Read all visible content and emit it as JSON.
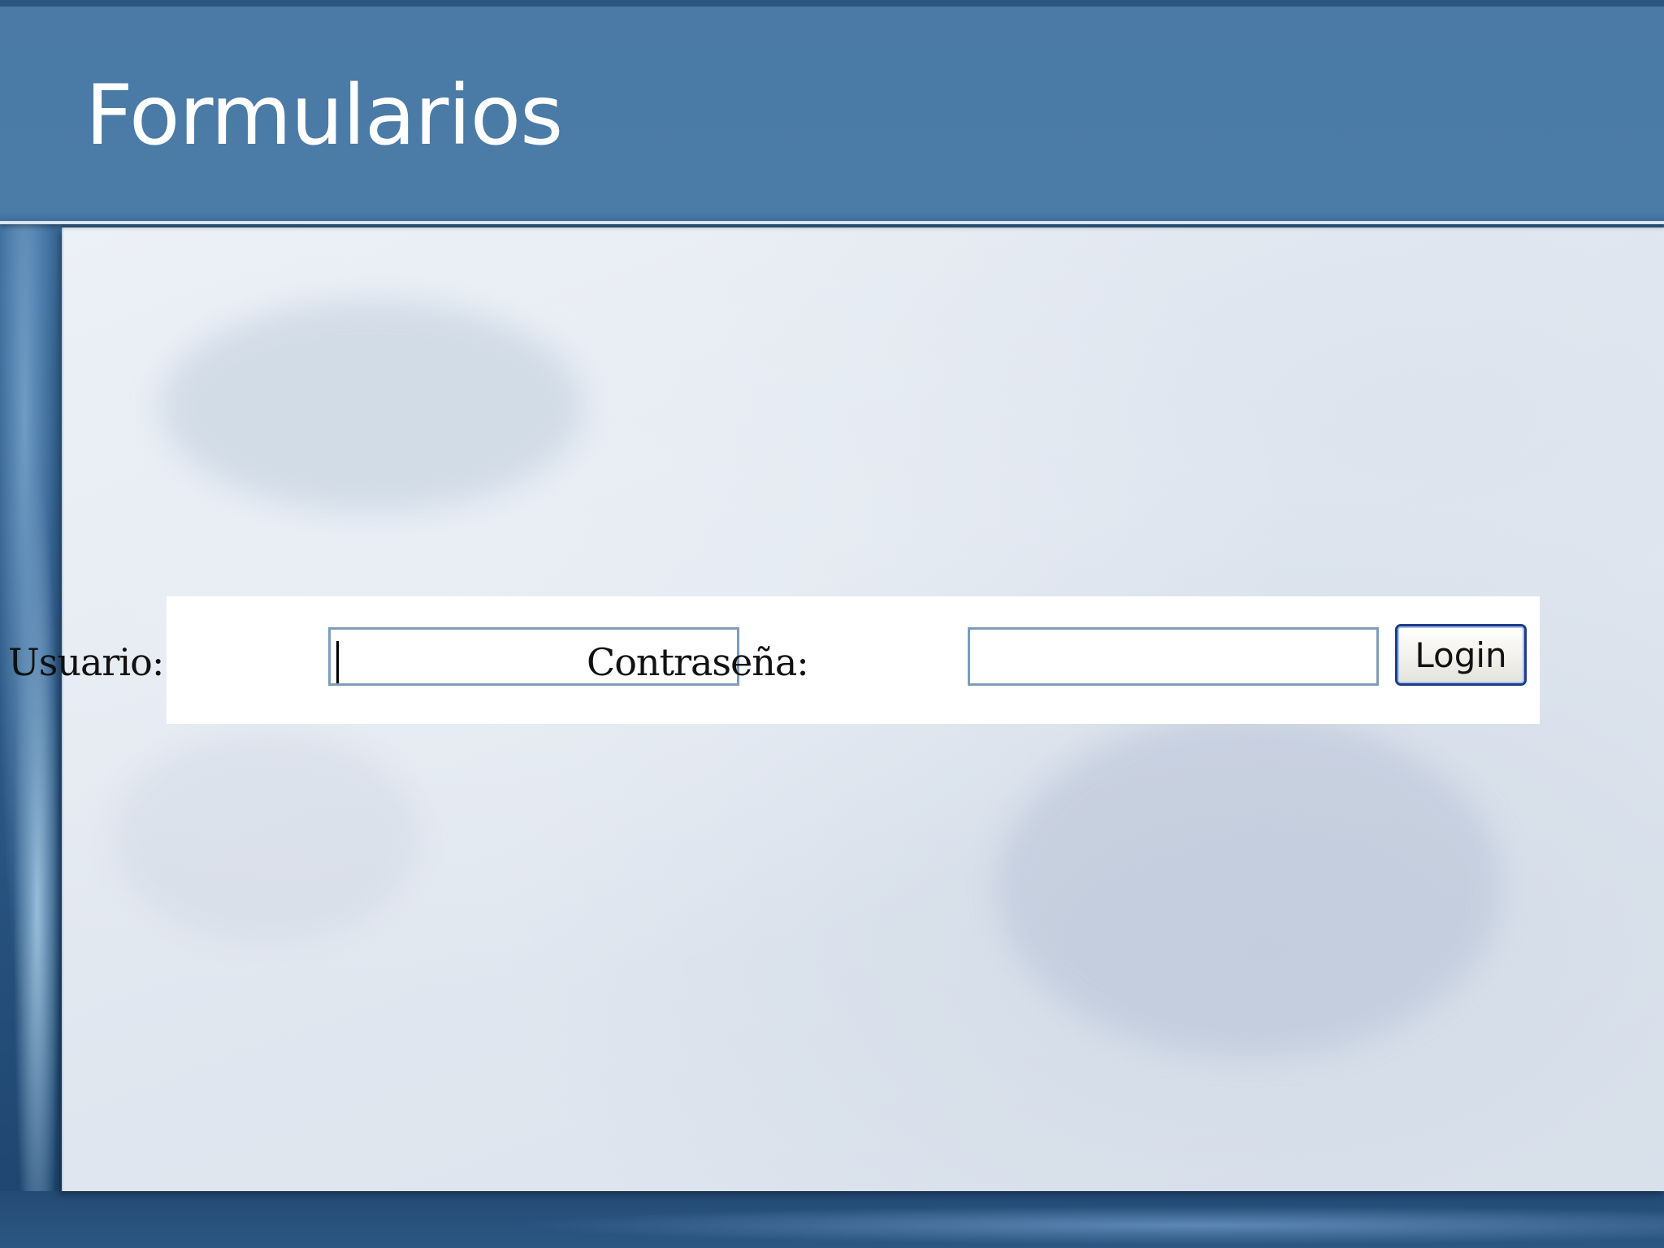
{
  "slide": {
    "title": "Formularios"
  },
  "form": {
    "username_label": "Usuario:",
    "username_value": "",
    "password_label": "Contraseña:",
    "password_value": "",
    "login_button_label": "Login"
  },
  "colors": {
    "header": "#4b7ca7",
    "title_text": "#ffffff",
    "input_border": "#7f9db9",
    "button_border": "#1c3c8a"
  }
}
